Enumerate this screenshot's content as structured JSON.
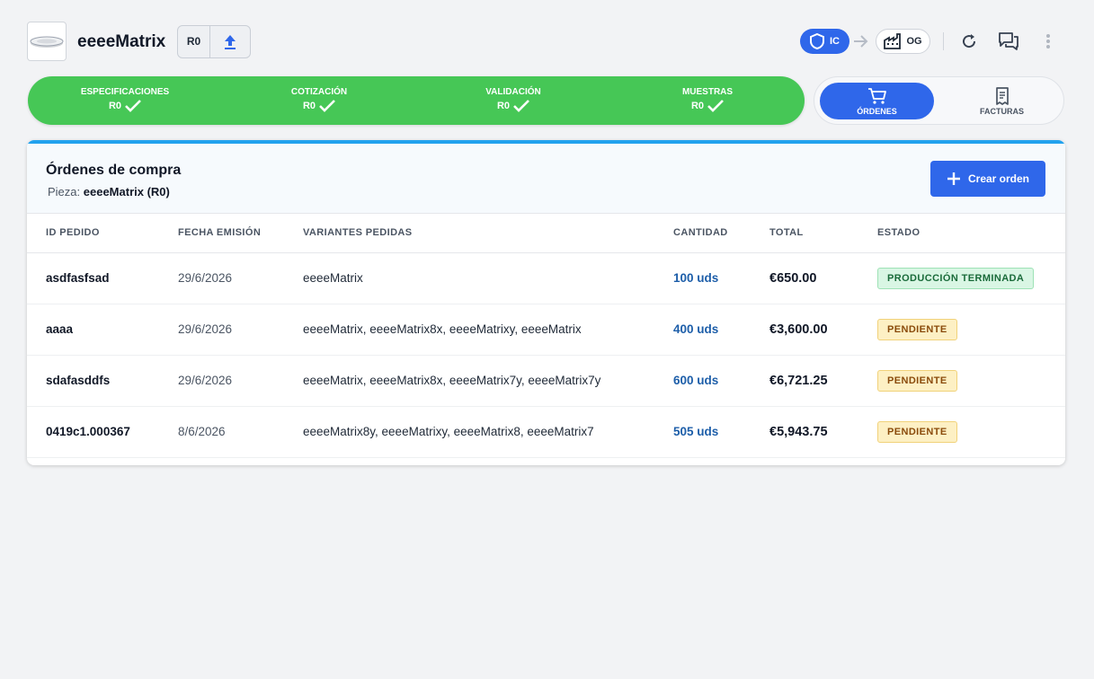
{
  "header": {
    "title": "eeeeMatrix",
    "revision": "R0",
    "ic_label": "IC",
    "og_label": "OG"
  },
  "progress": {
    "steps": [
      {
        "label": "ESPECIFICACIONES",
        "rev": "R0"
      },
      {
        "label": "COTIZACIÓN",
        "rev": "R0"
      },
      {
        "label": "VALIDACIÓN",
        "rev": "R0"
      },
      {
        "label": "MUESTRAS",
        "rev": "R0"
      }
    ]
  },
  "toggle": {
    "active_label": "ÓRDENES",
    "inactive_label": "FACTURAS"
  },
  "card": {
    "title": "Órdenes de compra",
    "sub_prefix": "Pieza:",
    "sub_value": "eeeeMatrix (R0)",
    "create_label": "Crear orden"
  },
  "table": {
    "columns": [
      "ID PEDIDO",
      "FECHA EMISIÓN",
      "VARIANTES PEDIDAS",
      "CANTIDAD",
      "TOTAL",
      "ESTADO"
    ],
    "rows": [
      {
        "id": "asdfasfsad",
        "date": "29/6/2026",
        "variants": "eeeeMatrix",
        "qty": "100 uds",
        "total": "€650.00",
        "status": "PRODUCCIÓN TERMINADA"
      },
      {
        "id": "aaaa",
        "date": "29/6/2026",
        "variants": "eeeeMatrix, eeeeMatrix8x, eeeeMatrixy, eeeeMatrix",
        "qty": "400 uds",
        "total": "€3,600.00",
        "status": "PENDIENTE"
      },
      {
        "id": "sdafasddfs",
        "date": "29/6/2026",
        "variants": "eeeeMatrix, eeeeMatrix8x, eeeeMatrix7y, eeeeMatrix7y",
        "qty": "600 uds",
        "total": "€6,721.25",
        "status": "PENDIENTE"
      },
      {
        "id": "0419c1.000367",
        "date": "8/6/2026",
        "variants": "eeeeMatrix8y, eeeeMatrixy, eeeeMatrix8, eeeeMatrix7",
        "qty": "505 uds",
        "total": "€5,943.75",
        "status": "PENDIENTE"
      }
    ]
  },
  "colors": {
    "accent": "#2f67ea",
    "progress_green": "#46c756",
    "card_top": "#22a2ee"
  }
}
